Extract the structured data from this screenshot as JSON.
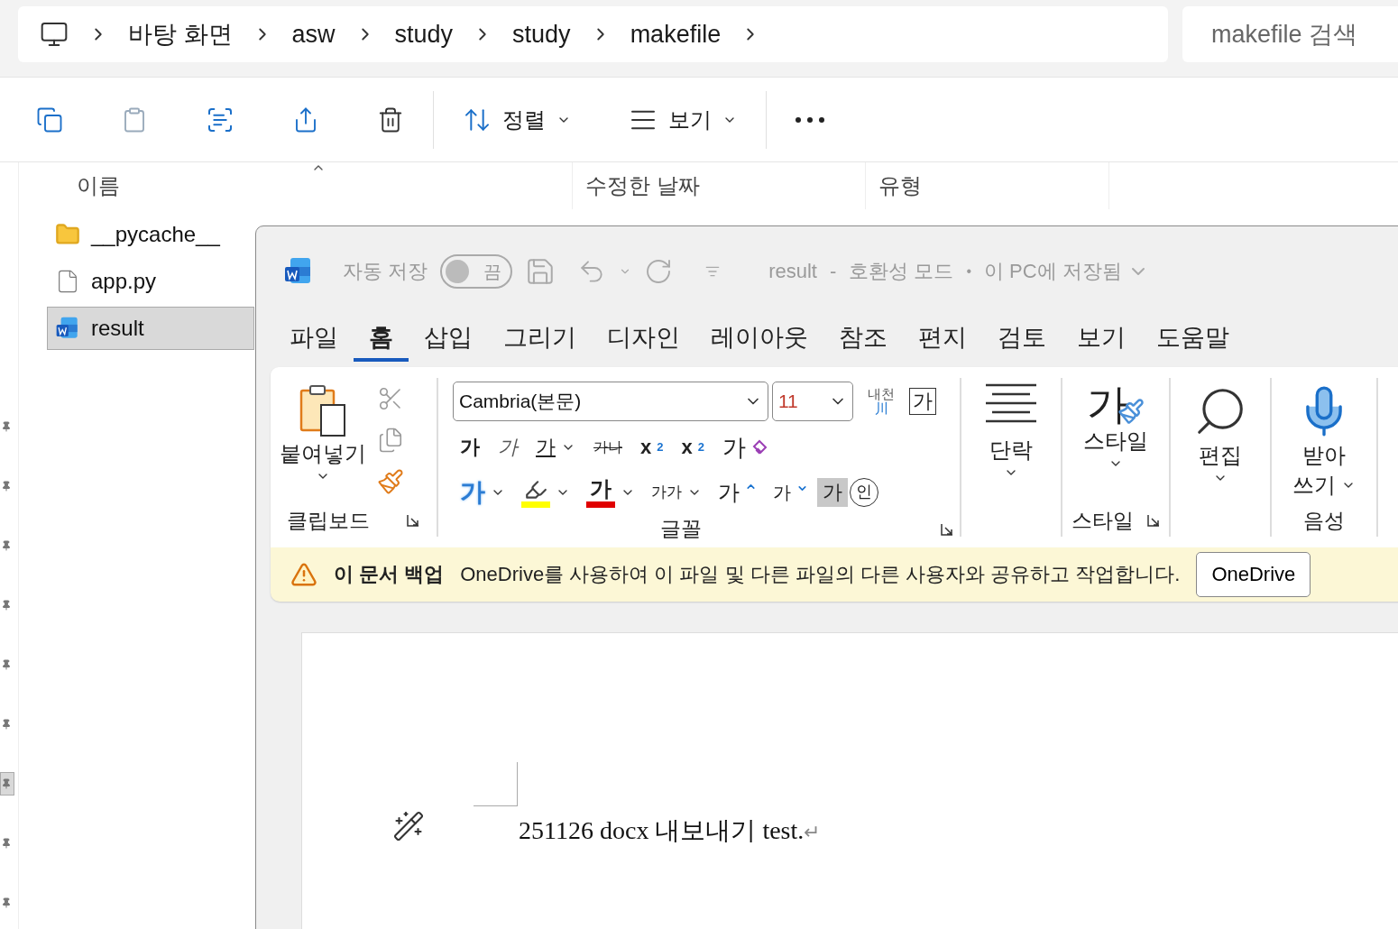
{
  "explorer": {
    "breadcrumb": [
      "바탕 화면",
      "asw",
      "study",
      "study",
      "makefile"
    ],
    "search": {
      "placeholder": "makefile 검색"
    },
    "toolbar": {
      "sort": "정렬",
      "view": "보기"
    },
    "columns": [
      "이름",
      "수정한 날짜",
      "유형"
    ],
    "files": [
      {
        "name": "__pycache__",
        "kind": "folder",
        "selected": false
      },
      {
        "name": "app.py",
        "kind": "file",
        "selected": false
      },
      {
        "name": "result",
        "kind": "word",
        "selected": true
      }
    ],
    "quick_access": [
      {
        "selected": false
      },
      {
        "selected": false
      },
      {
        "selected": false
      },
      {
        "selected": false
      },
      {
        "selected": false
      },
      {
        "selected": false
      },
      {
        "selected": true
      },
      {
        "selected": false
      },
      {
        "selected": false
      }
    ]
  },
  "word": {
    "autosave": {
      "label": "자동 저장",
      "state": "끔",
      "on": false
    },
    "title": {
      "name": "result",
      "separator": "-",
      "mode": "호환성 모드",
      "dot": "•",
      "saved": "이 PC에 저장됨"
    },
    "tabs": [
      {
        "label": "파일",
        "selected": false
      },
      {
        "label": "홈",
        "selected": true
      },
      {
        "label": "삽입",
        "selected": false
      },
      {
        "label": "그리기",
        "selected": false
      },
      {
        "label": "디자인",
        "selected": false
      },
      {
        "label": "레이아웃",
        "selected": false
      },
      {
        "label": "참조",
        "selected": false
      },
      {
        "label": "편지",
        "selected": false
      },
      {
        "label": "검토",
        "selected": false
      },
      {
        "label": "보기",
        "selected": false
      },
      {
        "label": "도움말",
        "selected": false
      }
    ],
    "clipboard": {
      "paste": "붙여넣기",
      "label": "클립보드"
    },
    "font": {
      "family": "Cambria(본문)",
      "size": "11",
      "phonetic": "내천",
      "phonetic_mark": "川",
      "border": "가",
      "label": "글꼴",
      "row1": [
        {
          "kind": "bold",
          "text": "가"
        },
        {
          "kind": "italic",
          "text": "가"
        },
        {
          "kind": "underline",
          "text": "가",
          "dropdown": true
        },
        {
          "kind": "strike",
          "text": "가나"
        },
        {
          "kind": "subscript",
          "text": "x",
          "sub": "2"
        },
        {
          "kind": "superscript",
          "text": "x",
          "sub": "2"
        },
        {
          "kind": "clear",
          "text": "가"
        }
      ],
      "row2": [
        {
          "kind": "effects",
          "text": "가",
          "dropdown": true
        },
        {
          "kind": "highlight",
          "color": "#ffff00",
          "dropdown": true
        },
        {
          "kind": "fontcolor",
          "text": "가",
          "color": "#e00000",
          "dropdown": true
        },
        {
          "kind": "case",
          "text": "가가",
          "dropdown": true
        },
        {
          "kind": "grow",
          "text": "가"
        },
        {
          "kind": "shrink",
          "text": "가"
        },
        {
          "kind": "shading",
          "text": "가"
        },
        {
          "kind": "enclose",
          "text": "인"
        }
      ]
    },
    "paragraph": {
      "label": "단락"
    },
    "styles": {
      "icon_text": "가",
      "label": "스타일",
      "group": "스타일"
    },
    "editing": {
      "label": "편집"
    },
    "voice": {
      "label_1": "받아",
      "label_2": "쓰기",
      "group": "음성"
    },
    "message": {
      "title": "이 문서 백업",
      "text": "OneDrive를 사용하여 이 파일 및 다른 파일의 다른 사용자와 공유하고 작업합니다.",
      "button": "OneDrive"
    },
    "document": {
      "text": "251126 docx 내보내기 test.",
      "mark": "↵"
    }
  }
}
